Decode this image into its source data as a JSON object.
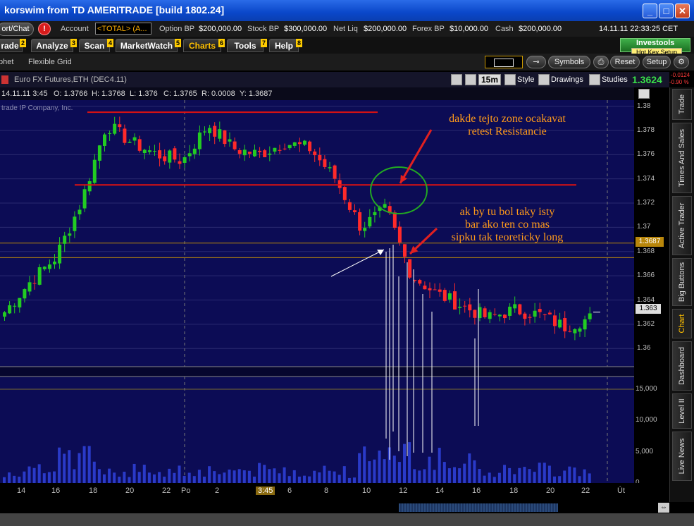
{
  "window": {
    "title": "korswim from TD AMERITRADE [build 1802.24]",
    "controls": [
      "_",
      "□",
      "✕"
    ]
  },
  "account_bar": {
    "export_label": "ort/Chat",
    "alert_icon": "!",
    "account_label": "Account",
    "account_value": "<TOTAL> (A...",
    "fields": [
      {
        "label": "Option BP",
        "value": "$200,000.00"
      },
      {
        "label": "Stock BP",
        "value": "$300,000.00"
      },
      {
        "label": "Net Liq",
        "value": "$200,000.00"
      },
      {
        "label": "Forex BP",
        "value": "$10,000.00"
      },
      {
        "label": "Cash",
        "value": "$200,000.00"
      }
    ],
    "datetime": "14.11.11 22:33:25 CET"
  },
  "tabs": [
    {
      "label": "rade",
      "num": "2"
    },
    {
      "label": "Analyze",
      "num": "3"
    },
    {
      "label": "Scan",
      "num": "4"
    },
    {
      "label": "MarketWatch",
      "num": "5"
    },
    {
      "label": "Charts",
      "num": "6",
      "active": true
    },
    {
      "label": "Tools",
      "num": "7"
    },
    {
      "label": "Help",
      "num": "8"
    }
  ],
  "investools": {
    "label": "Investools",
    "hotkey": "Hot Key Setup"
  },
  "subbar": {
    "left_items": [
      "phet",
      "Flexible Grid"
    ],
    "buttons": [
      "Symbols",
      "Reset",
      "Setup"
    ]
  },
  "chart_header": {
    "symbol": "Euro FX Futures,ETH (DEC4.11)",
    "timeframe": "15m",
    "style": "Style",
    "drawings": "Drawings",
    "studies": "Studies",
    "last_price": "1.3624",
    "change": "-0.0124",
    "change_pct": "-0.90 %"
  },
  "ohlc_bar": {
    "date": "14.11.11 3:45",
    "open": "O: 1.3766",
    "high": "H: 1.3768",
    "low": "L: 1.376",
    "close": "C: 1.3765",
    "range": "R: 0.0008",
    "y": "Y: 1.3687"
  },
  "watermark": "trade IP Company, Inc.",
  "annotations": {
    "top": [
      "dakde tejto zone ocakavat",
      "retest Resistancie"
    ],
    "mid": [
      "ak by tu bol taky isty",
      "bar ako ten co mas",
      "sipku tak teoreticky long"
    ]
  },
  "price_scale": {
    "ticks": [
      "1.38",
      "1.378",
      "1.376",
      "1.374",
      "1.372",
      "1.37",
      "1.368",
      "1.366",
      "1.364",
      "1.362",
      "1.36"
    ],
    "marker_y_label": "1.3687",
    "marker_last_label": "1.363"
  },
  "volume_scale": {
    "ticks": [
      "15,000",
      "10,000",
      "5,000",
      "0"
    ]
  },
  "time_axis": {
    "labels": [
      "14",
      "16",
      "18",
      "20",
      "22",
      "Po",
      "2",
      "3:45",
      "6",
      "8",
      "10",
      "12",
      "14",
      "16",
      "18",
      "20",
      "22",
      "Út"
    ]
  },
  "side_tabs": [
    "Trade",
    "Times And Sales",
    "Active Trader",
    "Big Buttons",
    "Chart",
    "Dashboard",
    "Level II",
    "Live News"
  ],
  "colors": {
    "up": "#22cc22",
    "down": "#ff2a2a",
    "background": "#0c0c55",
    "annotation": "#ff9a1a",
    "resistance_line": "#dd1111"
  },
  "chart_data": {
    "type": "candlestick",
    "xlabel": "",
    "ylabel": "",
    "ylim": [
      1.3585,
      1.3805
    ],
    "x": [
      "14",
      "16",
      "18",
      "20",
      "22",
      "Po",
      "2",
      "3:45",
      "6",
      "8",
      "10",
      "12",
      "14",
      "16",
      "18",
      "20",
      "22"
    ],
    "series": [
      {
        "values": [
          1.363,
          1.3655,
          1.3675,
          1.372,
          1.3785,
          1.377,
          1.376,
          1.3755,
          1.3785,
          1.3765,
          1.376,
          1.377,
          1.3765,
          1.374,
          1.37,
          1.3715,
          1.366,
          1.3645,
          1.3635,
          1.3625,
          1.3632,
          1.3628,
          1.3618,
          1.3625
        ]
      }
    ],
    "resistance_lines": [
      1.3795,
      1.3735
    ],
    "horizontal_levels": [
      1.3687,
      1.3675
    ],
    "volume_max": 15000
  }
}
